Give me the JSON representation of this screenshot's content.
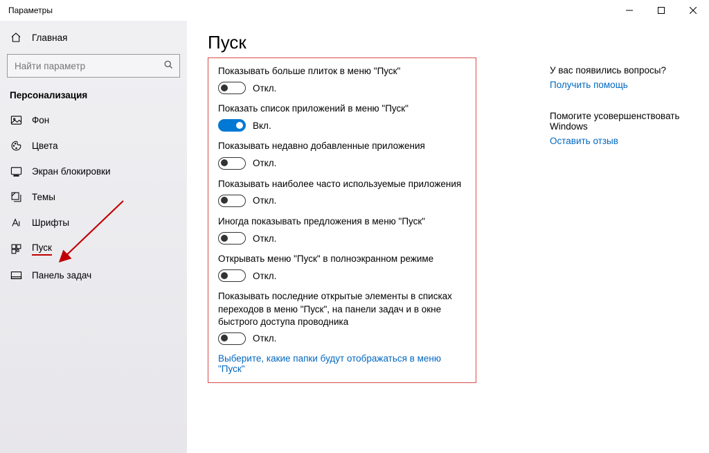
{
  "window": {
    "title": "Параметры"
  },
  "sidebar": {
    "home": "Главная",
    "search_placeholder": "Найти параметр",
    "section": "Персонализация",
    "items": [
      {
        "label": "Фон"
      },
      {
        "label": "Цвета"
      },
      {
        "label": "Экран блокировки"
      },
      {
        "label": "Темы"
      },
      {
        "label": "Шрифты"
      },
      {
        "label": "Пуск"
      },
      {
        "label": "Панель задач"
      }
    ]
  },
  "page": {
    "title": "Пуск",
    "settings": [
      {
        "label": "Показывать больше плиток в меню \"Пуск\"",
        "on": false
      },
      {
        "label": "Показать список приложений в меню \"Пуск\"",
        "on": true
      },
      {
        "label": "Показывать недавно добавленные приложения",
        "on": false
      },
      {
        "label": "Показывать наиболее часто используемые приложения",
        "on": false
      },
      {
        "label": "Иногда показывать предложения в меню \"Пуск\"",
        "on": false
      },
      {
        "label": "Открывать меню \"Пуск\" в полноэкранном режиме",
        "on": false
      },
      {
        "label": "Показывать последние открытые элементы в списках переходов в меню \"Пуск\", на панели задач и в окне быстрого доступа проводника",
        "on": false
      }
    ],
    "toggle_on_text": "Вкл.",
    "toggle_off_text": "Откл.",
    "bottom_link": "Выберите, какие папки будут отображаться в меню \"Пуск\""
  },
  "aside": {
    "q_title": "У вас появились вопросы?",
    "q_link": "Получить помощь",
    "fb_title": "Помогите усовершенствовать Windows",
    "fb_link": "Оставить отзыв"
  }
}
